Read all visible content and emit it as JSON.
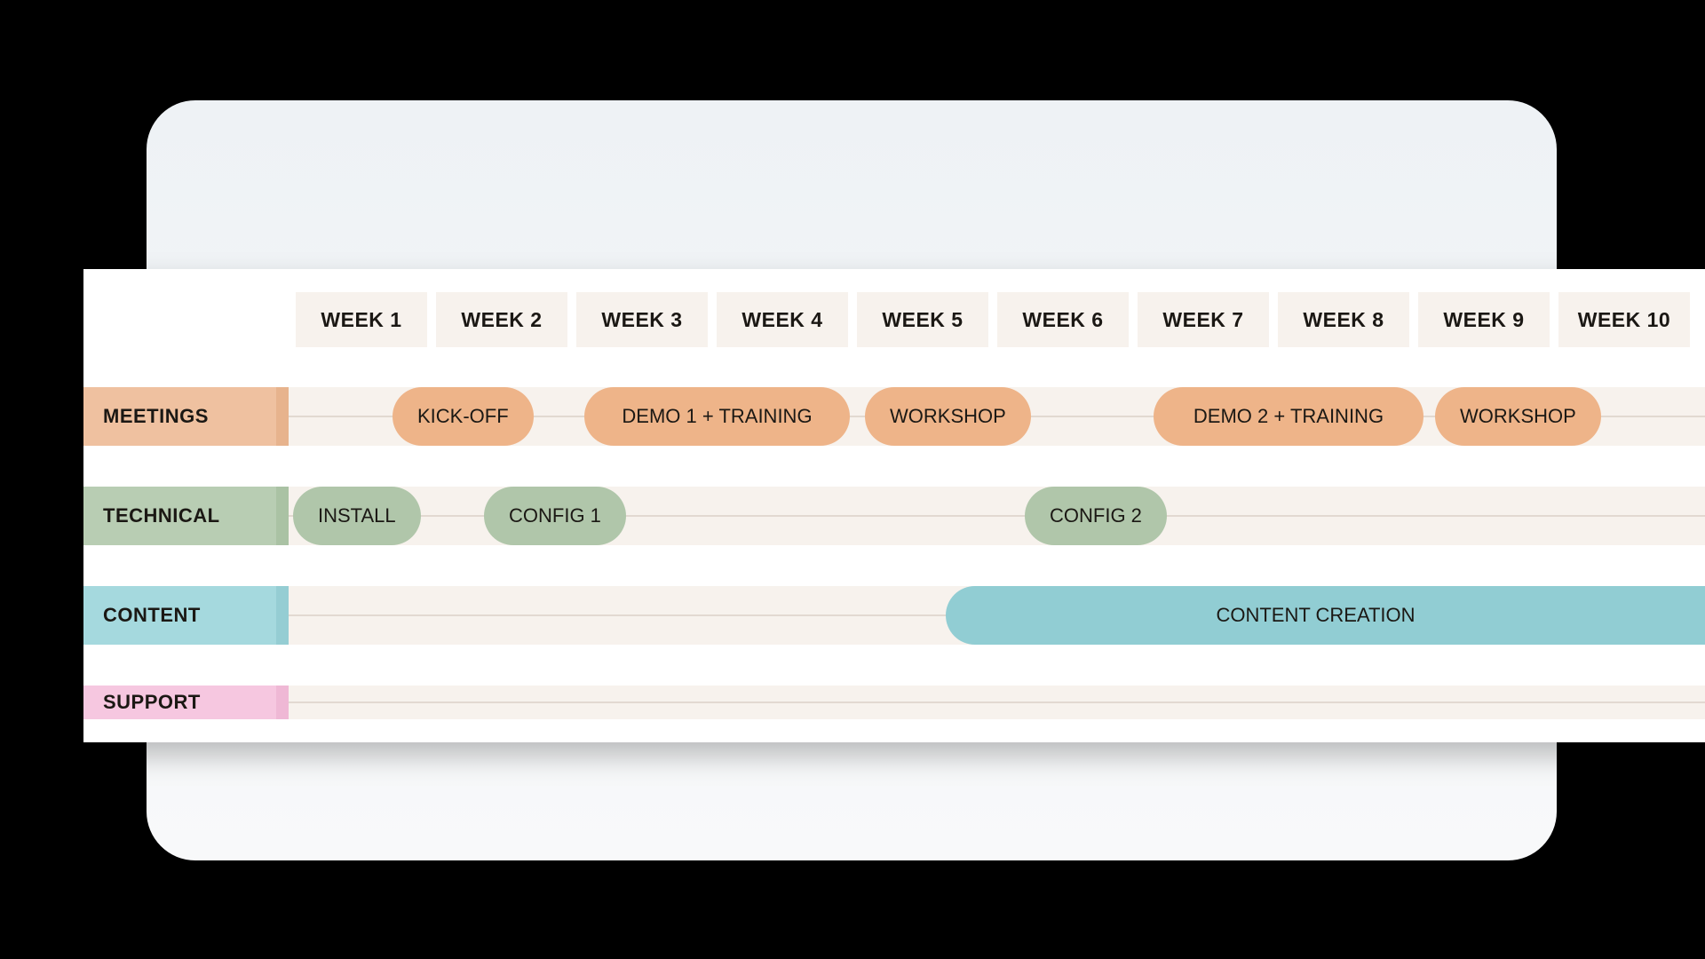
{
  "weeks": [
    "WEEK 1",
    "WEEK 2",
    "WEEK 3",
    "WEEK 4",
    "WEEK 5",
    "WEEK 6",
    "WEEK 7",
    "WEEK 8",
    "WEEK 9",
    "WEEK 10"
  ],
  "lanes": {
    "meetings": {
      "label": "MEETINGS",
      "items": [
        {
          "label": "KICK-OFF"
        },
        {
          "label": "DEMO 1 + TRAINING"
        },
        {
          "label": "WORKSHOP"
        },
        {
          "label": "DEMO 2 + TRAINING"
        },
        {
          "label": "WORKSHOP"
        }
      ]
    },
    "technical": {
      "label": "TECHNICAL",
      "items": [
        {
          "label": "INSTALL"
        },
        {
          "label": "CONFIG 1"
        },
        {
          "label": "CONFIG 2"
        }
      ]
    },
    "content": {
      "label": "CONTENT",
      "items": [
        {
          "label": "CONTENT CREATION"
        }
      ]
    },
    "support": {
      "label": "SUPPORT",
      "items": []
    }
  }
}
